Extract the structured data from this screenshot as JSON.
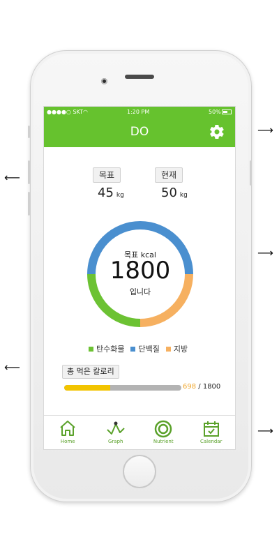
{
  "status": {
    "carrier": "●●●●○ SKT",
    "time": "1:20 PM",
    "battery": "50%"
  },
  "app": {
    "title": "DO"
  },
  "goal": {
    "label": "목표",
    "value": "45",
    "unit": "kg"
  },
  "current": {
    "label": "현재",
    "value": "50",
    "unit": "kg"
  },
  "ring": {
    "label": "목표 kcal",
    "value": "1800",
    "sub": "입니다"
  },
  "chart_data": {
    "type": "pie",
    "categories": [
      "탄수화물",
      "단백질",
      "지방"
    ],
    "values": [
      25,
      50,
      25
    ],
    "colors": [
      "#6cc233",
      "#4a8fcf",
      "#f6b060"
    ]
  },
  "legend": [
    {
      "label": "탄수화물",
      "color": "#6cc233"
    },
    {
      "label": "단백질",
      "color": "#4a8fcf"
    },
    {
      "label": "지방",
      "color": "#f6b060"
    }
  ],
  "calories": {
    "label": "총 먹은 칼로리",
    "eaten": "698",
    "separator": " / ",
    "target": "1800",
    "progress": 0.39
  },
  "tabs": [
    {
      "label": "Home",
      "icon": "home-icon"
    },
    {
      "label": "Graph",
      "icon": "graph-icon"
    },
    {
      "label": "Nutrient",
      "icon": "nutrient-icon"
    },
    {
      "label": "Calendar",
      "icon": "calendar-icon"
    }
  ]
}
